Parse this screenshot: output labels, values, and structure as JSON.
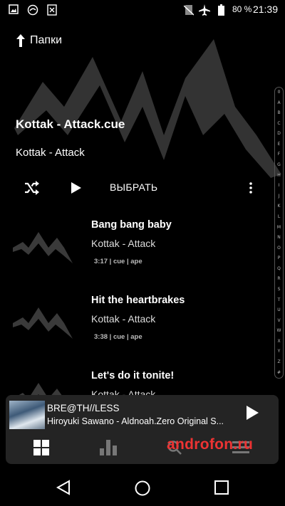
{
  "status_bar": {
    "battery": "80 %",
    "time": "21:39",
    "icons": [
      "image-icon",
      "sync-icon",
      "file-x-icon",
      "no-sim-icon",
      "airplane-icon",
      "battery-icon"
    ]
  },
  "header": {
    "nav_label": "Папки",
    "album_title": "Kottak - Attack.cue",
    "album_artist": "Kottak - Attack"
  },
  "controls": {
    "choose_label": "ВЫБРАТЬ"
  },
  "tracks": [
    {
      "title": "Bang bang baby",
      "artist": "Kottak - Attack",
      "meta": "3:17 | cue | ape"
    },
    {
      "title": "Hit the heartbrakes",
      "artist": "Kottak - Attack",
      "meta": "3:38 | cue | ape"
    },
    {
      "title": "Let's do it tonite!",
      "artist": "Kottak - Attack",
      "meta": ""
    }
  ],
  "alphabet": [
    "0",
    "A",
    "B",
    "C",
    "D",
    "E",
    "F",
    "G",
    "H",
    "I",
    "J",
    "K",
    "L",
    "M",
    "N",
    "O",
    "P",
    "Q",
    "R",
    "S",
    "T",
    "U",
    "V",
    "W",
    "X",
    "Y",
    "Z",
    "#"
  ],
  "mini_player": {
    "title": "BRE@TH//LESS",
    "subtitle": "Hiroyuki Sawano - Aldnoah.Zero Original S..."
  },
  "watermark": "androfon.ru",
  "colors": {
    "background": "#000000",
    "player_bg": "#242424",
    "art_gray": "#3a3a3a",
    "watermark": "#e33333"
  }
}
